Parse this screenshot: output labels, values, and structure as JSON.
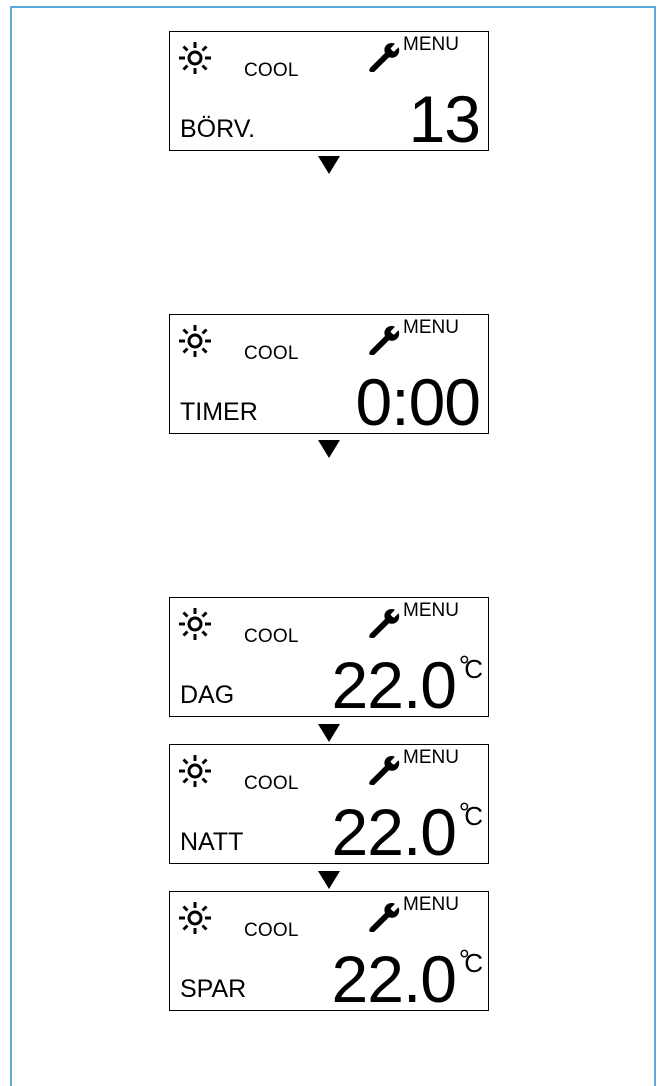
{
  "screens": [
    {
      "mode": "COOL",
      "menu": "MENU",
      "label": "BÖRV.",
      "value": "13"
    },
    {
      "mode": "COOL",
      "menu": "MENU",
      "label": "TIMER",
      "value": "0:00"
    },
    {
      "mode": "COOL",
      "menu": "MENU",
      "label": "DAG",
      "value": "22.0",
      "degree": "°",
      "unit": "C"
    },
    {
      "mode": "COOL",
      "menu": "MENU",
      "label": "NATT",
      "value": "22.0",
      "degree": "°",
      "unit": "C"
    },
    {
      "mode": "COOL",
      "menu": "MENU",
      "label": "SPAR",
      "value": "22.0",
      "degree": "°",
      "unit": "C"
    }
  ],
  "icons": {
    "mode_icon": "sun-icon",
    "settings_icon": "wrench-icon",
    "flow_arrow": "arrow-down-icon"
  },
  "colors": {
    "frame_border": "#5aa9d6"
  }
}
